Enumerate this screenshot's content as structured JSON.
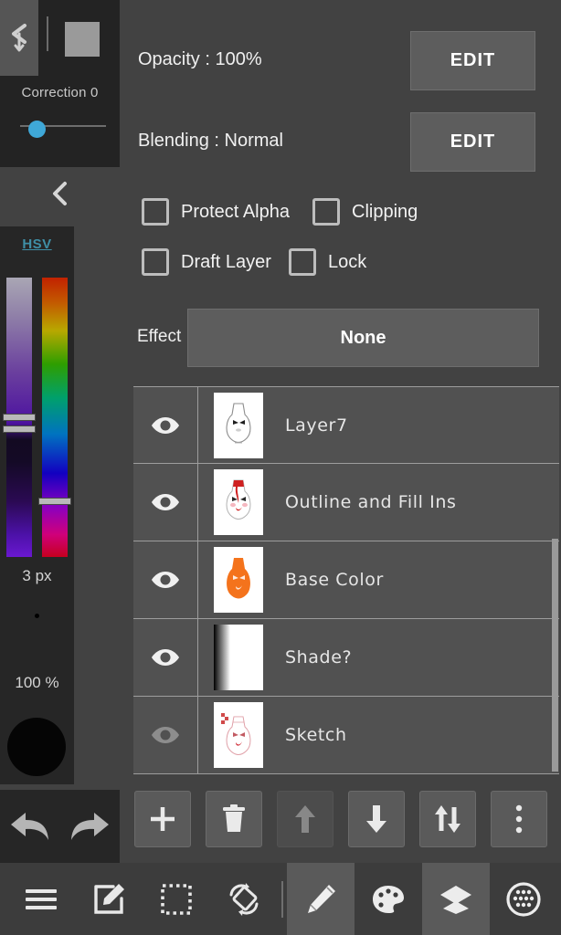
{
  "left_panel": {
    "back_icon": "chevron-left-down-icon",
    "brush_preview_color": "#9a9a9a",
    "correction": {
      "label": "Correction  0",
      "value": 0,
      "knob_color": "#3fa8d8"
    },
    "collapse_icon": "chevron-left-icon",
    "color_picker": {
      "mode_label": "HSV",
      "mode_link_color": "#3f8fa6",
      "sv_handles": [
        {
          "top_pct": 65
        },
        {
          "top_pct": 69
        }
      ],
      "hue_handle": {
        "top_pct": 92
      }
    },
    "brush_size_label": "3 px",
    "brush_opacity_label": "100 %",
    "brush_color": "#050505",
    "undo_icon": "undo-arrow-icon",
    "redo_icon": "redo-arrow-icon"
  },
  "properties": {
    "opacity": {
      "label": "Opacity : 100%",
      "value": "100%",
      "edit_label": "EDIT"
    },
    "blending": {
      "label": "Blending : Normal",
      "value": "Normal",
      "edit_label": "EDIT"
    }
  },
  "checkboxes": [
    {
      "label": "Protect Alpha",
      "checked": false,
      "name": "protect-alpha"
    },
    {
      "label": "Clipping",
      "checked": false,
      "name": "clipping"
    },
    {
      "label": "Draft Layer",
      "checked": false,
      "name": "draft-layer"
    },
    {
      "label": "Lock",
      "checked": false,
      "name": "lock"
    }
  ],
  "effect": {
    "label": "Effect",
    "value": "None"
  },
  "layers": [
    {
      "name": "Layer7",
      "visible": true,
      "thumb": "face-outline"
    },
    {
      "name": "Outline and Fill Ins",
      "visible": true,
      "thumb": "face-red"
    },
    {
      "name": "Base Color",
      "visible": true,
      "thumb": "face-orange"
    },
    {
      "name": "Shade?",
      "visible": true,
      "thumb": "gradient"
    },
    {
      "name": "Sketch",
      "visible": false,
      "thumb": "face-sketch"
    }
  ],
  "layer_tools": [
    {
      "name": "add-layer",
      "icon": "plus-icon",
      "label": "Add Layer",
      "enabled": true
    },
    {
      "name": "delete-layer",
      "icon": "trash-icon",
      "label": "Delete Layer",
      "enabled": true
    },
    {
      "name": "move-layer-up",
      "icon": "arrow-up-icon",
      "label": "Move Up",
      "enabled": false
    },
    {
      "name": "move-layer-down",
      "icon": "arrow-down-icon",
      "label": "Move Down",
      "enabled": true
    },
    {
      "name": "swap-layer",
      "icon": "arrows-up-down-icon",
      "label": "Swap",
      "enabled": true
    },
    {
      "name": "layer-more",
      "icon": "more-vertical-icon",
      "label": "More",
      "enabled": true
    }
  ],
  "bottom_nav": [
    {
      "name": "menu",
      "icon": "hamburger-menu-icon",
      "label": "Menu",
      "active": false
    },
    {
      "name": "edit-canvas",
      "icon": "edit-square-icon",
      "label": "Edit",
      "active": false
    },
    {
      "name": "selection",
      "icon": "dotted-selection-icon",
      "label": "Selection",
      "active": false
    },
    {
      "name": "transform",
      "icon": "rotate-flip-icon",
      "label": "Transform",
      "active": false
    },
    {
      "name": "brush",
      "icon": "pencil-icon",
      "label": "Brush",
      "active": true
    },
    {
      "name": "palette",
      "icon": "palette-icon",
      "label": "Palette",
      "active": false
    },
    {
      "name": "layers",
      "icon": "layers-icon",
      "label": "Layers",
      "active": true
    },
    {
      "name": "material",
      "icon": "circle-grid-icon",
      "label": "Material",
      "active": false
    }
  ],
  "colors": {
    "background": "#424242",
    "panel_dark": "#262626",
    "row": "#515151",
    "button": "#5d5d5d",
    "accent": "#3fa8d8"
  }
}
